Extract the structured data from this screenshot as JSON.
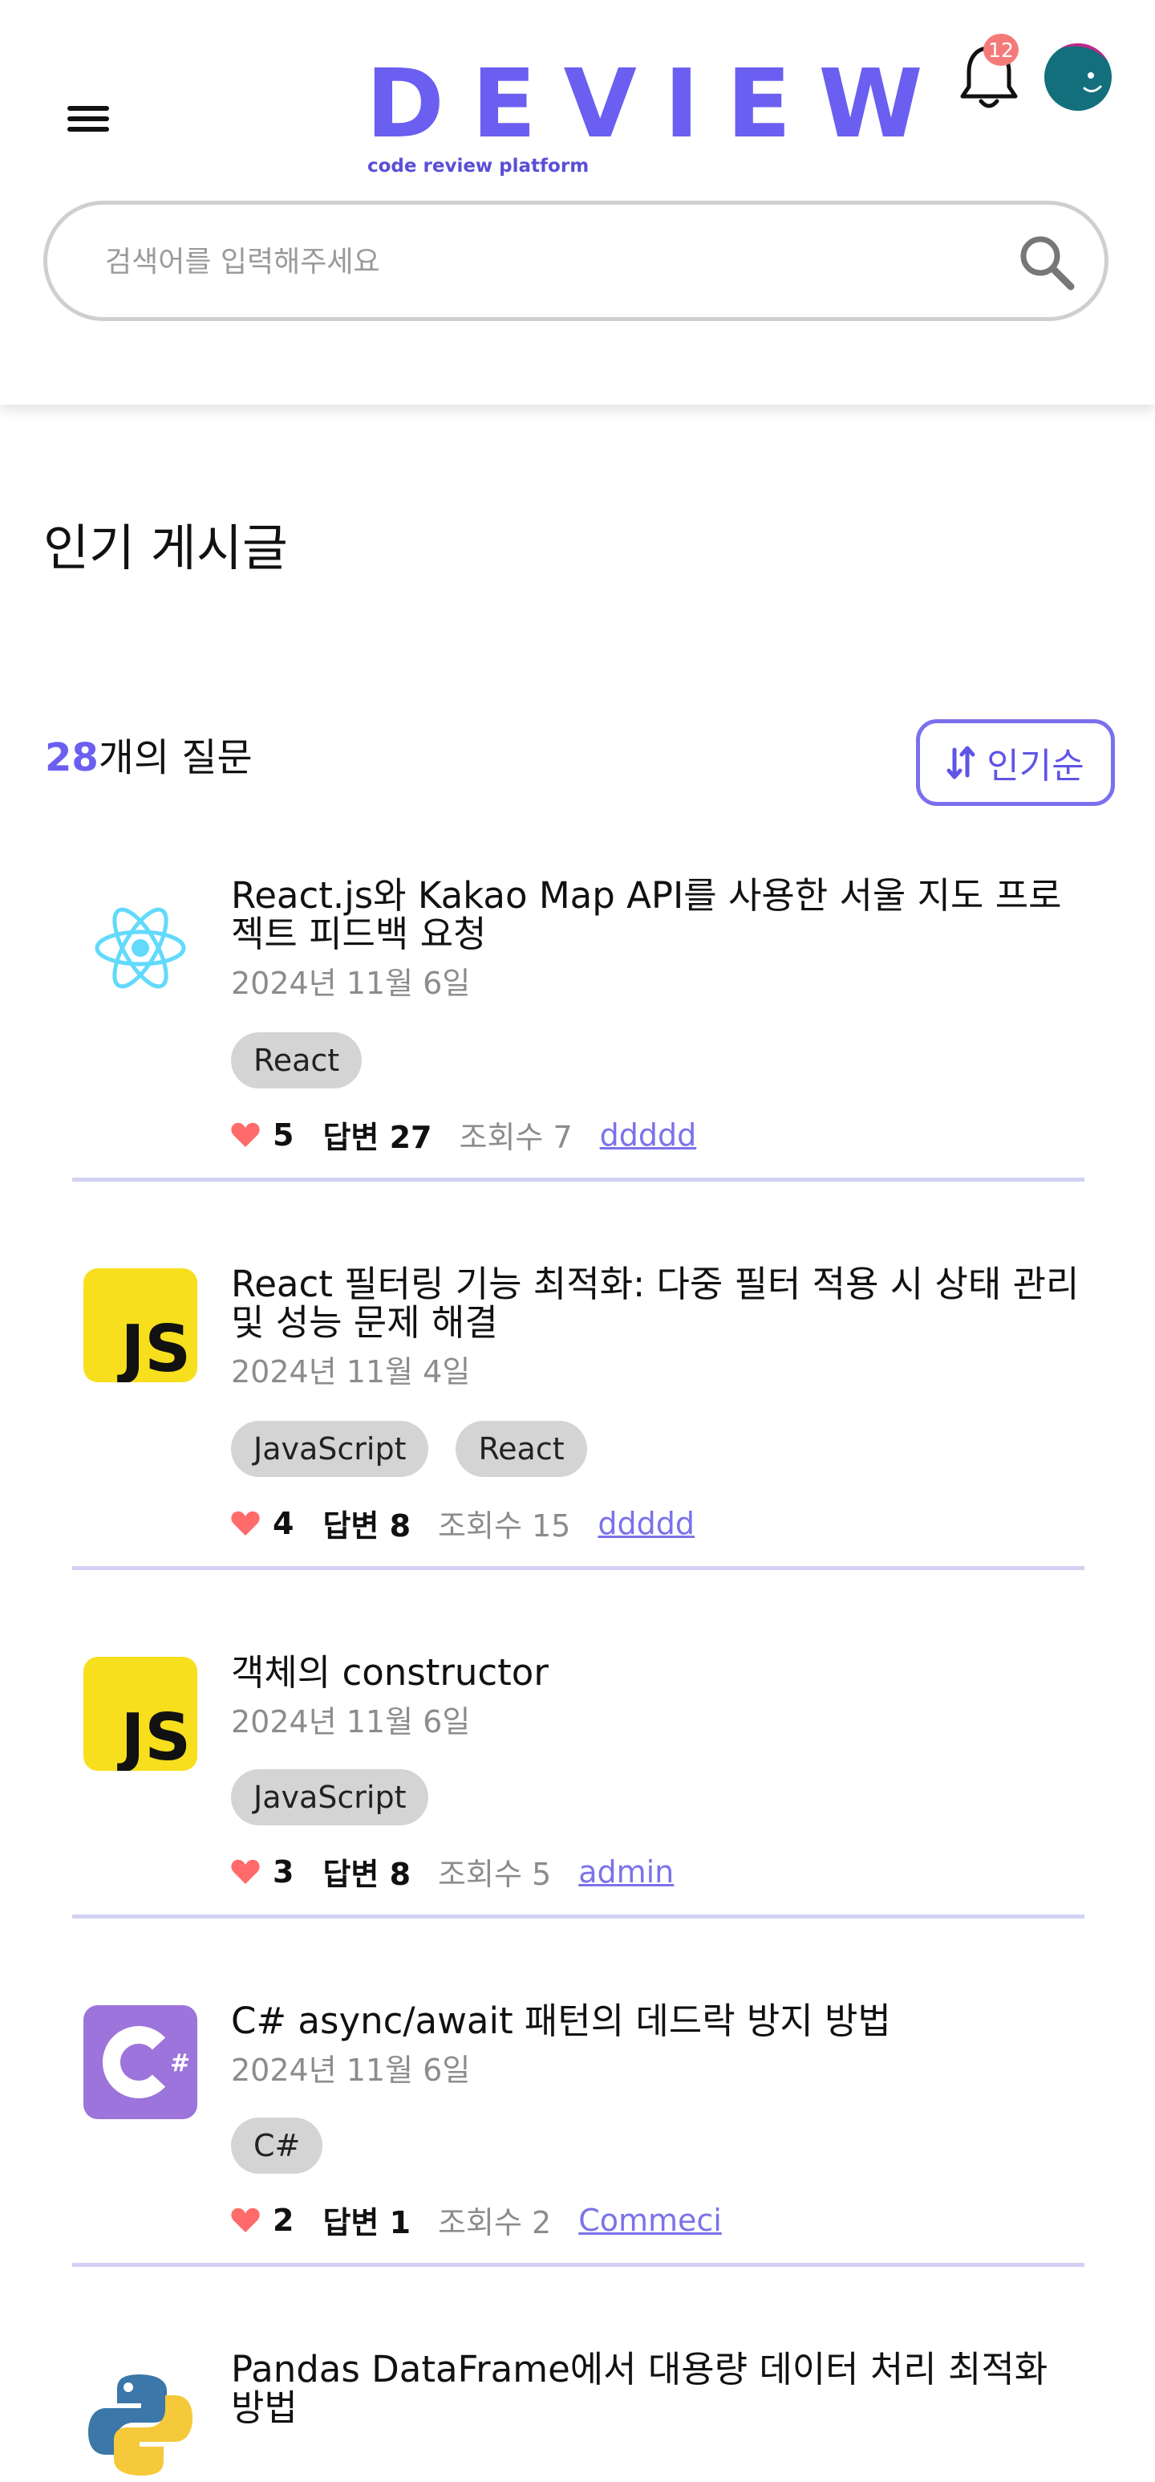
{
  "header": {
    "logo_text": "DEVIEW",
    "logo_tagline": "code review platform",
    "notification_count": "12",
    "search_placeholder": "검색어를 입력해주세요"
  },
  "section": {
    "title": "인기 게시글",
    "question_count": "28",
    "question_count_suffix": "개의 질문",
    "sort_label": "인기순"
  },
  "colors": {
    "accent": "#6a5ff0",
    "badge": "#f47a7a",
    "heart": "#ff6b6b",
    "divider": "#d2d1f4"
  },
  "posts": [
    {
      "icon": "react-icon",
      "title": "React.js와 Kakao Map API를 사용한 서울 지도 프로젝트 피드백 요청",
      "date": "2024년 11월 6일",
      "tags": [
        "React"
      ],
      "likes": "5",
      "answers": "답변 27",
      "views": "조회수 7",
      "author": "ddddd"
    },
    {
      "icon": "javascript-icon",
      "title": "React 필터링 기능 최적화: 다중 필터 적용 시 상태 관리 및 성능 문제 해결",
      "date": "2024년 11월 4일",
      "tags": [
        "JavaScript",
        "React"
      ],
      "likes": "4",
      "answers": "답변 8",
      "views": "조회수 15",
      "author": "ddddd"
    },
    {
      "icon": "javascript-icon",
      "title": "객체의 constructor",
      "date": "2024년 11월 6일",
      "tags": [
        "JavaScript"
      ],
      "likes": "3",
      "answers": "답변 8",
      "views": "조회수 5",
      "author": "admin"
    },
    {
      "icon": "csharp-icon",
      "title": "C# async/await 패턴의 데드락 방지 방법",
      "date": "2024년 11월 6일",
      "tags": [
        "C#"
      ],
      "likes": "2",
      "answers": "답변 1",
      "views": "조회수 2",
      "author": "Commeci"
    },
    {
      "icon": "python-icon",
      "title": "Pandas DataFrame에서 대용량 데이터 처리 최적화 방법"
    }
  ]
}
